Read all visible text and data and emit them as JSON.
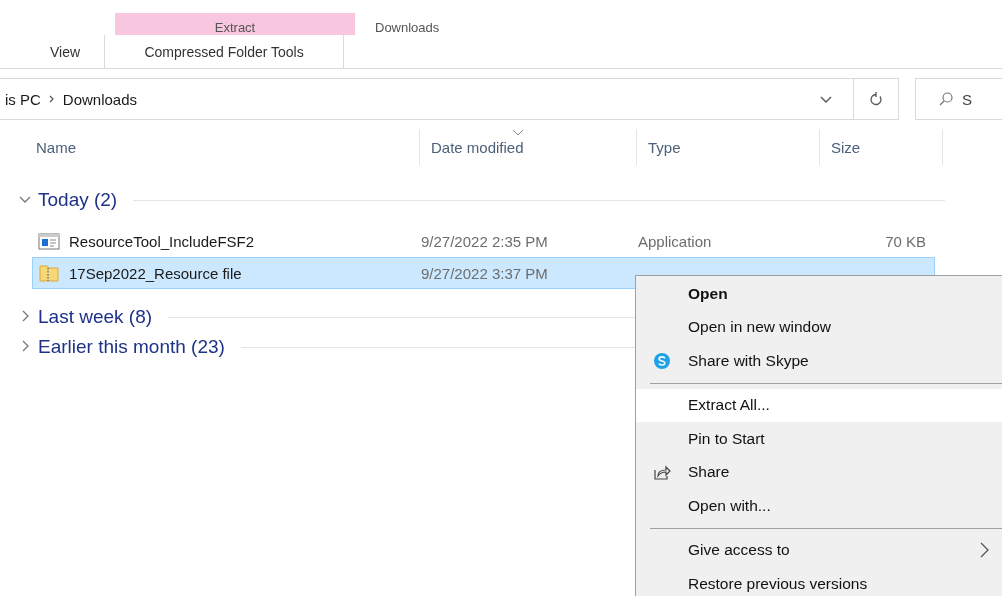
{
  "ribbon": {
    "context_header": "Extract",
    "window_title": "Downloads",
    "tabs": [
      {
        "label": "View",
        "selected": false
      },
      {
        "label": "Compressed Folder Tools",
        "selected": true
      }
    ]
  },
  "address_bar": {
    "path": [
      {
        "label": "is PC"
      },
      {
        "label": "Downloads"
      }
    ]
  },
  "search": {
    "placeholder": "S"
  },
  "columns": [
    {
      "label": "Name",
      "sorted": false
    },
    {
      "label": "Date modified",
      "sorted": true
    },
    {
      "label": "Type",
      "sorted": false
    },
    {
      "label": "Size",
      "sorted": false
    }
  ],
  "groups": [
    {
      "label": "Today (2)",
      "expanded": true,
      "rows": [
        {
          "name": "ResourceTool_IncludeFSF2",
          "kind": "application",
          "date": "9/27/2022 2:35 PM",
          "type": "Application",
          "size": "70 KB",
          "selected": false
        },
        {
          "name": "17Sep2022_Resource file",
          "kind": "zip",
          "date": "9/27/2022 3:37 PM",
          "selected": true
        }
      ]
    },
    {
      "label": "Last week (8)",
      "expanded": false
    },
    {
      "label": "Earlier this month (23)",
      "expanded": false
    }
  ],
  "context_menu": [
    {
      "kind": "bold",
      "label": "Open",
      "selected": false
    },
    {
      "kind": "plain",
      "label": "Open in new window",
      "selected": false
    },
    {
      "kind": "skype",
      "label": "Share with Skype",
      "selected": false
    },
    {
      "kind": "separator"
    },
    {
      "kind": "plain",
      "label": "Extract All...",
      "selected": true
    },
    {
      "kind": "plain",
      "label": "Pin to Start",
      "selected": false
    },
    {
      "kind": "share",
      "label": "Share",
      "selected": false
    },
    {
      "kind": "plain",
      "label": "Open with...",
      "selected": false
    },
    {
      "kind": "separator"
    },
    {
      "kind": "submenu",
      "label": "Give access to",
      "selected": false
    },
    {
      "kind": "plain",
      "label": "Restore previous versions",
      "selected": false
    }
  ]
}
